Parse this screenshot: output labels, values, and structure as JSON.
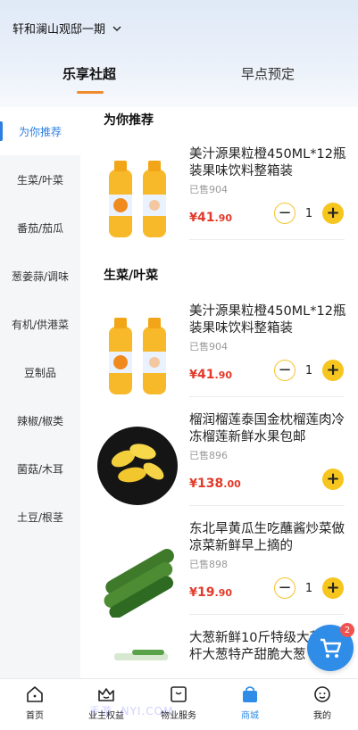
{
  "location": {
    "name": "轩和澜山观邸一期"
  },
  "tabs": [
    {
      "label": "乐享社超"
    },
    {
      "label": "早点预定"
    }
  ],
  "sidebar": {
    "items": [
      {
        "label": "为你推荐"
      },
      {
        "label": "生菜/叶菜"
      },
      {
        "label": "番茄/茄瓜"
      },
      {
        "label": "葱姜蒜/调味"
      },
      {
        "label": "有机/供港菜"
      },
      {
        "label": "豆制品"
      },
      {
        "label": "辣椒/椒类"
      },
      {
        "label": "菌菇/木耳"
      },
      {
        "label": "土豆/根茎"
      }
    ]
  },
  "sections": [
    {
      "title": "为你推荐"
    },
    {
      "title": "生菜/叶菜"
    }
  ],
  "products": [
    {
      "name": "美汁源果粒橙450ML*12瓶装果味饮料整箱装",
      "sold": "已售904",
      "currency": "¥",
      "price_int": "41",
      "price_dec": ".90",
      "qty": "1",
      "minus": "−",
      "plus": "+"
    },
    {
      "name": "美汁源果粒橙450ML*12瓶装果味饮料整箱装",
      "sold": "已售904",
      "currency": "¥",
      "price_int": "41",
      "price_dec": ".90",
      "qty": "1",
      "minus": "−",
      "plus": "+"
    },
    {
      "name": "榴润榴莲泰国金枕榴莲肉冷冻榴莲新鲜水果包邮",
      "sold": "已售896",
      "currency": "¥",
      "price_int": "138",
      "price_dec": ".00",
      "plus": "+"
    },
    {
      "name": "东北旱黄瓜生吃蘸酱炒菜做凉菜新鲜早上摘的",
      "sold": "已售898",
      "currency": "¥",
      "price_int": "19",
      "price_dec": ".90",
      "qty": "1",
      "minus": "−",
      "plus": "+"
    },
    {
      "name": "大葱新鲜10斤特级大葱铁杆大葱特产甜脆大葱"
    }
  ],
  "cart": {
    "badge": "2"
  },
  "tabbar": [
    {
      "label": "首页"
    },
    {
      "label": "业主权益"
    },
    {
      "label": "物业服务"
    },
    {
      "label": "商城"
    },
    {
      "label": "我的"
    }
  ],
  "watermark": "手游 .NYI.COM",
  "colors": {
    "accent": "#2f8de8",
    "price": "#e23a2a",
    "button": "#f6c51e",
    "tab_underline": "#f08a2b"
  }
}
